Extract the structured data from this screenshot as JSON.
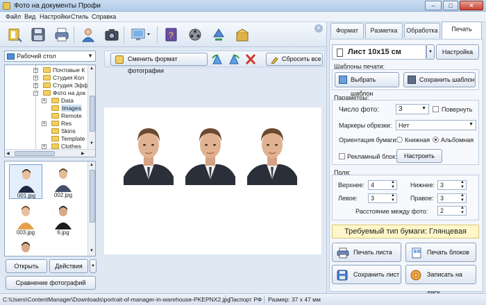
{
  "window": {
    "title": "Фото на документы Профи",
    "min": "–",
    "max": "□",
    "close": "✕"
  },
  "menu": [
    "Файл",
    "Вид",
    "Настройки",
    "Стиль",
    "Справка"
  ],
  "toolbar_icons": [
    "wizard-icon",
    "save-icon",
    "print-icon",
    "users-icon",
    "camera-icon",
    "screen-icon",
    "help-icon",
    "video-icon",
    "recycle-icon",
    "box-icon"
  ],
  "left": {
    "folder_combo": "Рабочий стол",
    "tree": [
      {
        "label": "Почтовые К",
        "indent": 0,
        "exp": "+"
      },
      {
        "label": "Студия Кол",
        "indent": 0,
        "exp": "+"
      },
      {
        "label": "Студия Эфф",
        "indent": 0,
        "exp": "+"
      },
      {
        "label": "Фото на док",
        "indent": 0,
        "exp": "−"
      },
      {
        "label": "Data",
        "indent": 1,
        "exp": "+"
      },
      {
        "label": "Images",
        "indent": 1,
        "exp": "",
        "selected": true
      },
      {
        "label": "Remote",
        "indent": 1,
        "exp": ""
      },
      {
        "label": "Res",
        "indent": 1,
        "exp": "+"
      },
      {
        "label": "Skins",
        "indent": 1,
        "exp": ""
      },
      {
        "label": "Template",
        "indent": 1,
        "exp": ""
      },
      {
        "label": "Clothes",
        "indent": 1,
        "exp": "+"
      }
    ],
    "thumbs": [
      {
        "name": "001.jpg",
        "kind": "woman"
      },
      {
        "name": "002.jpg",
        "kind": "woman2"
      },
      {
        "name": "003.jpg",
        "kind": "woman3"
      },
      {
        "name": "6.jpg",
        "kind": "man"
      },
      {
        "name": "",
        "kind": "man2"
      }
    ],
    "open_label": "Открыть",
    "actions_label": "Действия",
    "compare_label": "Сравнение фотографий"
  },
  "center": {
    "change_format_label": "Сменить формат фотографии",
    "reset_all_label": "Сбросить все",
    "photo_count": 3
  },
  "right": {
    "tabs": [
      "Формат",
      "Разметка",
      "Обработка",
      "Печать"
    ],
    "active_tab": 3,
    "sheet_label": "Лист 10x15 см",
    "settings_label": "Настройка",
    "templates_heading": "Шаблоны печати:",
    "choose_template_label": "Выбрать шаблон",
    "save_template_label": "Сохранить шаблон",
    "params_heading": "Параметры:",
    "photo_count_label": "Число фото:",
    "photo_count_value": "3",
    "rotate_label": "Повернуть",
    "cut_markers_label": "Маркеры обрезки:",
    "cut_markers_value": "Нет",
    "orientation_label": "Ориентация бумаги:",
    "orientation_portrait": "Книжная",
    "orientation_landscape": "Альбомная",
    "ad_block_label": "Рекламный блок:",
    "configure_label": "Настроить",
    "margins_heading": "Поля:",
    "top_label": "Верхнее:",
    "top_value": "4",
    "bottom_label": "Нижнее:",
    "bottom_value": "3",
    "left_label": "Левое:",
    "left_value": "3",
    "right_label": "Правое:",
    "right_value": "3",
    "gap_label": "Расстояние между фото:",
    "gap_value": "2",
    "paper_type_label": "Требуемый тип бумаги: Глянцевая",
    "print_sheet_label": "Печать листа",
    "print_blocks_label": "Печать блоков",
    "save_sheet_label": "Сохранить лист",
    "burn_disc_label": "Записать на диск"
  },
  "status": {
    "path": "C:\\Users\\ContentManager\\Downloads\\portrait-of-manager-in-warehouse-PKEPNX2.jpg",
    "format": "Паспорт РФ",
    "size": "Размер: 37 x 47 мм"
  },
  "colors": {
    "accent": "#4f8ed8",
    "paper_bar": "#fff7c9",
    "window_bg": "#dfe8f3"
  }
}
